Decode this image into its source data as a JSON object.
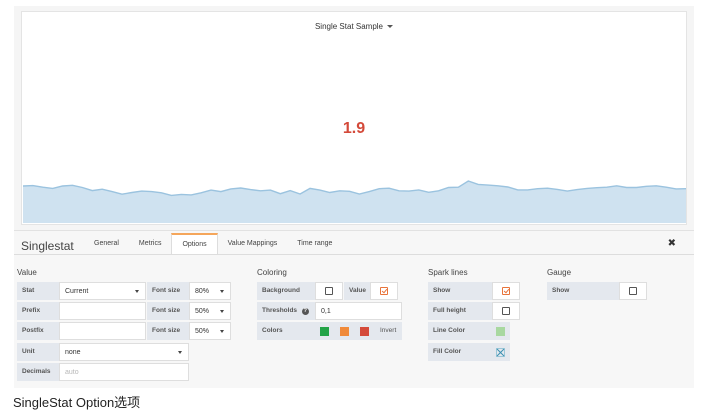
{
  "panel": {
    "title": "Single Stat Sample",
    "value": "1.9",
    "value_color": "#d44a3a",
    "sparkline": {
      "fill_color": "#cfe2f0",
      "line_color": "#9bc3df",
      "points": [
        0.79,
        0.81,
        0.74,
        0.69,
        0.79,
        0.82,
        0.73,
        0.6,
        0.66,
        0.56,
        0.45,
        0.52,
        0.58,
        0.56,
        0.51,
        0.4,
        0.44,
        0.42,
        0.51,
        0.62,
        0.56,
        0.67,
        0.71,
        0.64,
        0.59,
        0.62,
        0.47,
        0.6,
        0.46,
        0.69,
        0.62,
        0.52,
        0.59,
        0.57,
        0.46,
        0.56,
        0.68,
        0.7,
        0.59,
        0.58,
        0.63,
        0.53,
        0.59,
        0.73,
        0.74,
        1.0,
        0.86,
        0.83,
        0.8,
        0.75,
        0.63,
        0.63,
        0.68,
        0.7,
        0.65,
        0.58,
        0.64,
        0.69,
        0.72,
        0.74,
        0.8,
        0.73,
        0.73,
        0.78,
        0.8,
        0.74,
        0.67,
        0.68
      ]
    }
  },
  "editor": {
    "title": "Singlestat",
    "tabs": [
      "General",
      "Metrics",
      "Options",
      "Value Mappings",
      "Time range"
    ],
    "active_tab": "Options",
    "close_icon": "close-icon",
    "value": {
      "section": "Value",
      "stat_label": "Stat",
      "stat_value": "Current",
      "font_size_label": "Font size",
      "stat_font_size": "80%",
      "prefix_label": "Prefix",
      "prefix_value": "",
      "prefix_font_size": "50%",
      "postfix_label": "Postfix",
      "postfix_value": "",
      "postfix_font_size": "50%",
      "unit_label": "Unit",
      "unit_value": "none",
      "decimals_label": "Decimals",
      "decimals_placeholder": "auto"
    },
    "coloring": {
      "section": "Coloring",
      "background_label": "Background",
      "background_checked": false,
      "value_label": "Value",
      "value_checked": true,
      "thresholds_label": "Thresholds",
      "thresholds_help_icon": "question-circle-icon",
      "thresholds_value": "0,1",
      "colors_label": "Colors",
      "colors": [
        "#23a347",
        "#f08a3a",
        "#d44a3a"
      ],
      "invert_label": "Invert"
    },
    "spark_lines": {
      "section": "Spark lines",
      "show_label": "Show",
      "show_checked": true,
      "full_height_label": "Full height",
      "full_height_checked": false,
      "line_color_label": "Line Color",
      "line_color": "#a8d8a0",
      "fill_color_label": "Fill Color",
      "fill_color_icon": "no-color-icon"
    },
    "gauge": {
      "section": "Gauge",
      "show_label": "Show",
      "show_checked": false
    }
  },
  "caption": "SingleStat Option选项"
}
